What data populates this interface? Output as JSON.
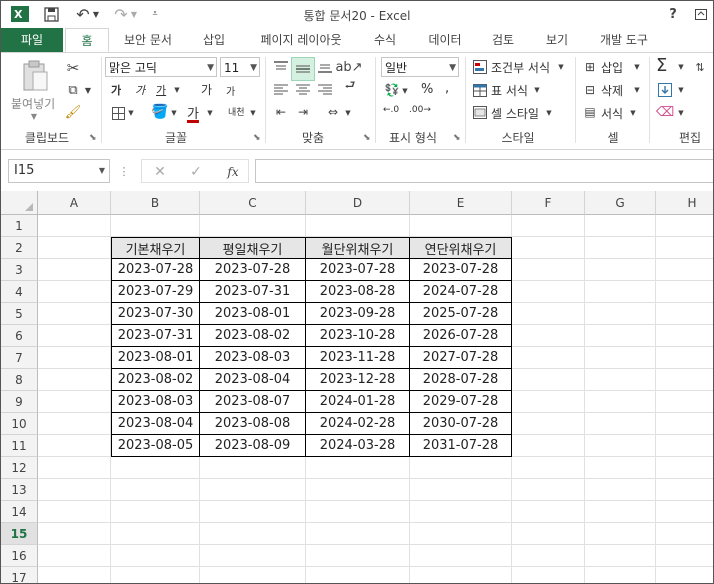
{
  "app": {
    "title": "통합 문서20 - Excel"
  },
  "titlebar": {
    "help": "?"
  },
  "tabs": [
    {
      "label": "파일"
    },
    {
      "label": "홈"
    },
    {
      "label": "보안 문서"
    },
    {
      "label": "삽입"
    },
    {
      "label": "페이지 레이아웃"
    },
    {
      "label": "수식"
    },
    {
      "label": "데이터"
    },
    {
      "label": "검토"
    },
    {
      "label": "보기"
    },
    {
      "label": "개발 도구"
    }
  ],
  "ribbon": {
    "clipboard": {
      "paste_label": "붙여넣기",
      "group": "클립보드"
    },
    "font": {
      "name": "맑은 고딕",
      "size": "11",
      "bold": "가",
      "italic": "가",
      "underline": "가",
      "grow": "가",
      "shrink": "가",
      "color_letter": "가",
      "phonetic": "내천",
      "group": "글꼴"
    },
    "align": {
      "group": "맞춤"
    },
    "number": {
      "format": "일반",
      "percent": "%",
      "group": "표시 형식"
    },
    "styles": {
      "cond": "조건부 서식",
      "table": "표 서식",
      "cell": "셀 스타일",
      "group": "스타일"
    },
    "cells": {
      "insert": "삽입",
      "delete": "삭제",
      "format": "서식",
      "group": "셀"
    },
    "editing": {
      "sum": "Σ",
      "group": "편집"
    }
  },
  "formula_bar": {
    "name_box": "I15",
    "value": ""
  },
  "grid": {
    "columns": [
      "A",
      "B",
      "C",
      "D",
      "E",
      "F",
      "G",
      "H"
    ],
    "rows": [
      "1",
      "2",
      "3",
      "4",
      "5",
      "6",
      "7",
      "8",
      "9",
      "10",
      "11",
      "12",
      "13",
      "14",
      "15",
      "16",
      "17"
    ],
    "active_row": "15",
    "table": {
      "headers": [
        "기본채우기",
        "평일채우기",
        "월단위채우기",
        "연단위채우기"
      ],
      "rows": [
        [
          "2023-07-28",
          "2023-07-28",
          "2023-07-28",
          "2023-07-28"
        ],
        [
          "2023-07-29",
          "2023-07-31",
          "2023-08-28",
          "2024-07-28"
        ],
        [
          "2023-07-30",
          "2023-08-01",
          "2023-09-28",
          "2025-07-28"
        ],
        [
          "2023-07-31",
          "2023-08-02",
          "2023-10-28",
          "2026-07-28"
        ],
        [
          "2023-08-01",
          "2023-08-03",
          "2023-11-28",
          "2027-07-28"
        ],
        [
          "2023-08-02",
          "2023-08-04",
          "2023-12-28",
          "2028-07-28"
        ],
        [
          "2023-08-03",
          "2023-08-07",
          "2024-01-28",
          "2029-07-28"
        ],
        [
          "2023-08-04",
          "2023-08-08",
          "2024-02-28",
          "2030-07-28"
        ],
        [
          "2023-08-05",
          "2023-08-09",
          "2024-03-28",
          "2031-07-28"
        ]
      ]
    }
  },
  "colors": {
    "accent": "#217346",
    "header_fill": "#e7e6e6",
    "font_color_bar": "#c00000"
  }
}
